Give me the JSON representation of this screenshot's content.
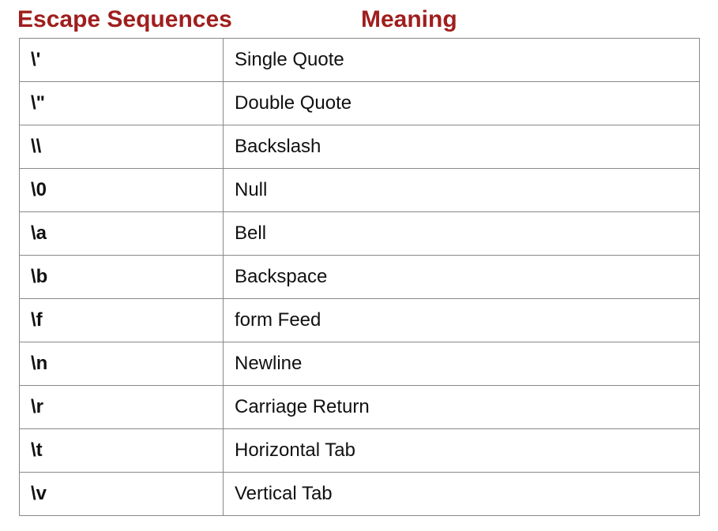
{
  "headers": {
    "left": "Escape Sequences",
    "right": "Meaning"
  },
  "rows": [
    {
      "seq": "\\'",
      "meaning": "Single Quote"
    },
    {
      "seq": "\\\"",
      "meaning": "Double Quote"
    },
    {
      "seq": "\\\\",
      "meaning": "Backslash"
    },
    {
      "seq": "\\0",
      "meaning": "Null"
    },
    {
      "seq": "\\a",
      "meaning": "Bell"
    },
    {
      "seq": "\\b",
      "meaning": "Backspace"
    },
    {
      "seq": "\\f",
      "meaning": "form Feed"
    },
    {
      "seq": "\\n",
      "meaning": "Newline"
    },
    {
      "seq": "\\r",
      "meaning": "Carriage Return"
    },
    {
      "seq": "\\t",
      "meaning": "Horizontal Tab"
    },
    {
      "seq": "\\v",
      "meaning": "Vertical Tab"
    }
  ]
}
